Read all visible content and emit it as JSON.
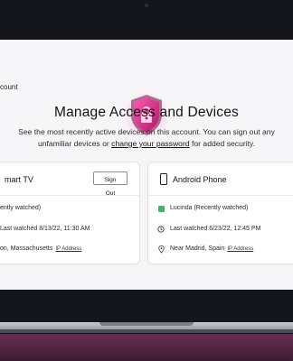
{
  "breadcrumb": "count",
  "header": {
    "title": "Manage Access and Devices",
    "subtitle_line1": "See the most recently active devices on this account. You can sign out any",
    "subtitle_line2_pre": "unfamiliar devices or ",
    "subtitle_link": "change your password",
    "subtitle_line2_post": " for added security."
  },
  "devices": [
    {
      "name": "mart TV",
      "sign_out_label": "Sign Out",
      "profile": "ently watched)",
      "last_watched": "Last watched 8/13/22, 11:30 AM",
      "location": "on, Massachusetts",
      "ip_label": "IP Address"
    },
    {
      "name": "Android Phone",
      "profile": "Lucinda (Recently watched)",
      "last_watched": "Last watched 6/23/22, 12:45 PM",
      "location": "Near Madrid, Spain",
      "ip_label": "IP Address",
      "profile_color": "#3fb56b"
    }
  ],
  "colors": {
    "shield": "#e0217f",
    "accent_bg": "#f6f6f8"
  },
  "icons": [
    "shield-lock-icon",
    "phone-icon",
    "clock-icon",
    "location-pin-icon"
  ]
}
